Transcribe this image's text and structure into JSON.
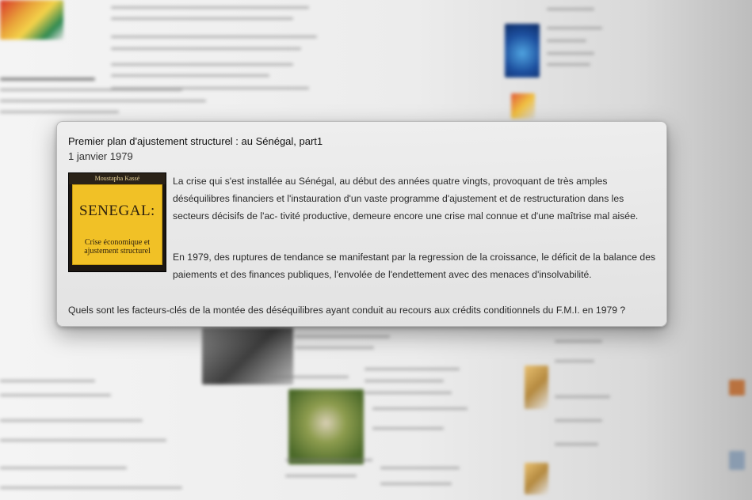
{
  "article": {
    "title": "Premier plan d'ajustement structurel : au Sénégal, part1",
    "date": "1 janvier 1979",
    "paragraph_1": "La crise qui s'est installée au Sénégal, au début des années quatre vingts, provoquant de très amples déséquilibres financiers et l'instauration d'un vaste programme d'ajustement et de restructuration dans les secteurs décisifs de l'ac- tivité productive, demeure encore une crise mal connue et d'une maîtrise mal aisée.",
    "paragraph_2": "En 1979, des ruptures de tendance se manifestant par la regression de la croissance, le déficit de la balance des paiements et des finances publiques, l'envolée de l'endettement avec des menaces d'insolvabilité.",
    "question": "Quels sont les facteurs-clés de la montée des déséquilibres ayant conduit au recours aux crédits conditionnels du F.M.I. en 1979 ?"
  },
  "cover": {
    "author": "Moustapha Kassé",
    "title_word": "SENEGAL:",
    "subtitle": "Crise économique et ajustement structurel"
  },
  "colors": {
    "cover_yellow": "#f1c126",
    "cover_dark": "#1c1712",
    "card_background": "#e6e6e6"
  }
}
